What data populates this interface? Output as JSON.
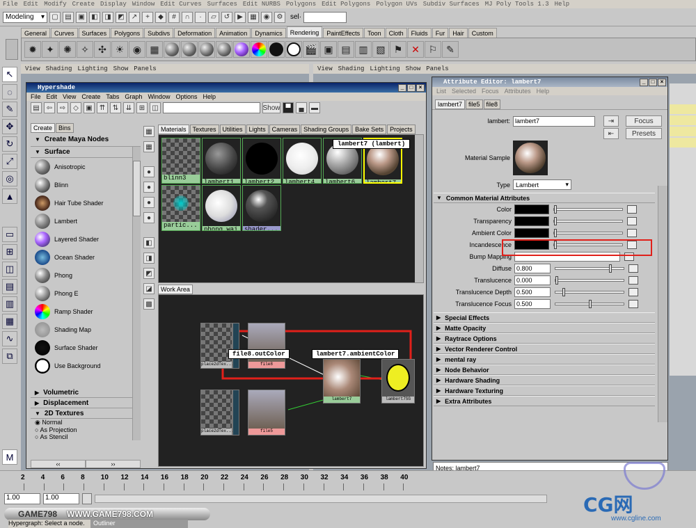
{
  "menubar": [
    "File",
    "Edit",
    "Modify",
    "Create",
    "Display",
    "Window",
    "Edit Curves",
    "Surfaces",
    "Edit NURBS",
    "Polygons",
    "Edit Polygons",
    "Polygon UVs",
    "Subdiv Surfaces",
    "MJ Poly Tools 1.3",
    "Help"
  ],
  "status": {
    "mode": "Modeling",
    "sel_label": "sel·"
  },
  "shelf_tabs": [
    "General",
    "Curves",
    "Surfaces",
    "Polygons",
    "Subdivs",
    "Deformation",
    "Animation",
    "Dynamics",
    "Rendering",
    "PaintEffects",
    "Toon",
    "Cloth",
    "Fluids",
    "Fur",
    "Hair",
    "Custom"
  ],
  "shelf_active": "Rendering",
  "panel_menu": [
    "View",
    "Shading",
    "Lighting",
    "Show",
    "Panels"
  ],
  "hypershade": {
    "title": "Hypershade",
    "menu": [
      "File",
      "Edit",
      "View",
      "Create",
      "Tabs",
      "Graph",
      "Window",
      "Options",
      "Help"
    ],
    "show_label": "Show",
    "left_tabs": [
      "Create",
      "Bins"
    ],
    "create_header": "Create Maya Nodes",
    "surface_header": "Surface",
    "surface_items": [
      "Anisotropic",
      "Blinn",
      "Hair Tube Shader",
      "Lambert",
      "Layered Shader",
      "Ocean Shader",
      "Phong",
      "Phong E",
      "Ramp Shader",
      "Shading Map",
      "Surface Shader",
      "Use Background"
    ],
    "sections": [
      "Volumetric",
      "Displacement",
      "2D Textures"
    ],
    "tex_options": [
      "Normal",
      "As Projection",
      "As Stencil"
    ],
    "top_tabs": [
      "Materials",
      "Textures",
      "Utilities",
      "Lights",
      "Cameras",
      "Shading Groups",
      "Bake Sets",
      "Projects"
    ],
    "materials": [
      "blinn3",
      "lambert1",
      "lambert2",
      "lambert4",
      "lambert6",
      "lambert7",
      "partic...",
      "phong_wai",
      "shader..."
    ],
    "tooltip": "lambert7 (lambert)",
    "work_area_tab": "Work Area",
    "work_nodes": {
      "n1": "place2dTex...",
      "n2": "file8",
      "n3": "place2dTex...",
      "n4": "file5",
      "n5": "lambert7",
      "n6": "lambert7SG"
    },
    "conn_from": "file8.outColor",
    "conn_to": "lambert7.ambientColor"
  },
  "attr": {
    "title": "Attribute Editor: lambert7",
    "menu": [
      "List",
      "Selected",
      "Focus",
      "Attributes",
      "Help"
    ],
    "tabs": [
      "lambert7",
      "file5",
      "file8"
    ],
    "name_label": "lambert:",
    "name_value": "lambert7",
    "focus": "Focus",
    "presets": "Presets",
    "sample_label": "Material Sample",
    "type_label": "Type",
    "type_value": "Lambert",
    "common_header": "Common Material Attributes",
    "rows": [
      {
        "label": "Color",
        "kind": "swatch",
        "pos": 0.0
      },
      {
        "label": "Transparency",
        "kind": "swatch",
        "pos": 0.0
      },
      {
        "label": "Ambient Color",
        "kind": "swatch",
        "pos": 0.0
      },
      {
        "label": "Incandescence",
        "kind": "swatch",
        "pos": 0.0
      },
      {
        "label": "Bump Mapping",
        "kind": "blank"
      },
      {
        "label": "Diffuse",
        "kind": "num",
        "value": "0.800",
        "pos": 0.8
      },
      {
        "label": "Translucence",
        "kind": "num",
        "value": "0.000",
        "pos": 0.0
      },
      {
        "label": "Translucence Depth",
        "kind": "num",
        "value": "0.500",
        "pos": 0.1
      },
      {
        "label": "Translucence Focus",
        "kind": "num",
        "value": "0.500",
        "pos": 0.5
      }
    ],
    "sections": [
      "Special Effects",
      "Matte Opacity",
      "Raytrace Options",
      "Vector Renderer Control",
      "mental ray",
      "Node Behavior",
      "Hardware Shading",
      "Hardware Texturing",
      "Extra Attributes"
    ],
    "notes": "Notes: lambert7"
  },
  "timeline": {
    "ticks": [
      "2",
      "4",
      "6",
      "8",
      "10",
      "12",
      "14",
      "16",
      "18",
      "20",
      "22",
      "24",
      "26",
      "28",
      "30",
      "32",
      "34",
      "36",
      "38",
      "40"
    ],
    "start": "1.00",
    "cur": "1.00"
  },
  "footer": {
    "brand1": "GAME798",
    "brand2": "WWW.GAME798.COM",
    "help": "Hypergraph: Select a node.",
    "outliner": "Outliner",
    "cg": "CG网",
    "site": "www.cgline.com"
  },
  "colors": {
    "highlight": "#e0201a",
    "title": "#0a246a"
  }
}
